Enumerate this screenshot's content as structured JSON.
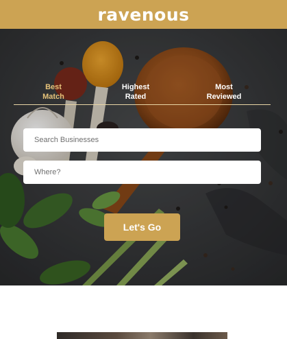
{
  "header": {
    "logo": "ravenous",
    "background": "#cca353"
  },
  "sort_tabs": [
    {
      "line1": "Best",
      "line2": "Match",
      "active": true
    },
    {
      "line1": "Highest",
      "line2": "Rated",
      "active": false
    },
    {
      "line1": "Most",
      "line2": "Reviewed",
      "active": false
    }
  ],
  "search": {
    "term_placeholder": "Search Businesses",
    "location_placeholder": "Where?"
  },
  "submit_label": "Let's Go",
  "colors": {
    "accent": "#cca353",
    "active_tab": "#e6c37a"
  }
}
